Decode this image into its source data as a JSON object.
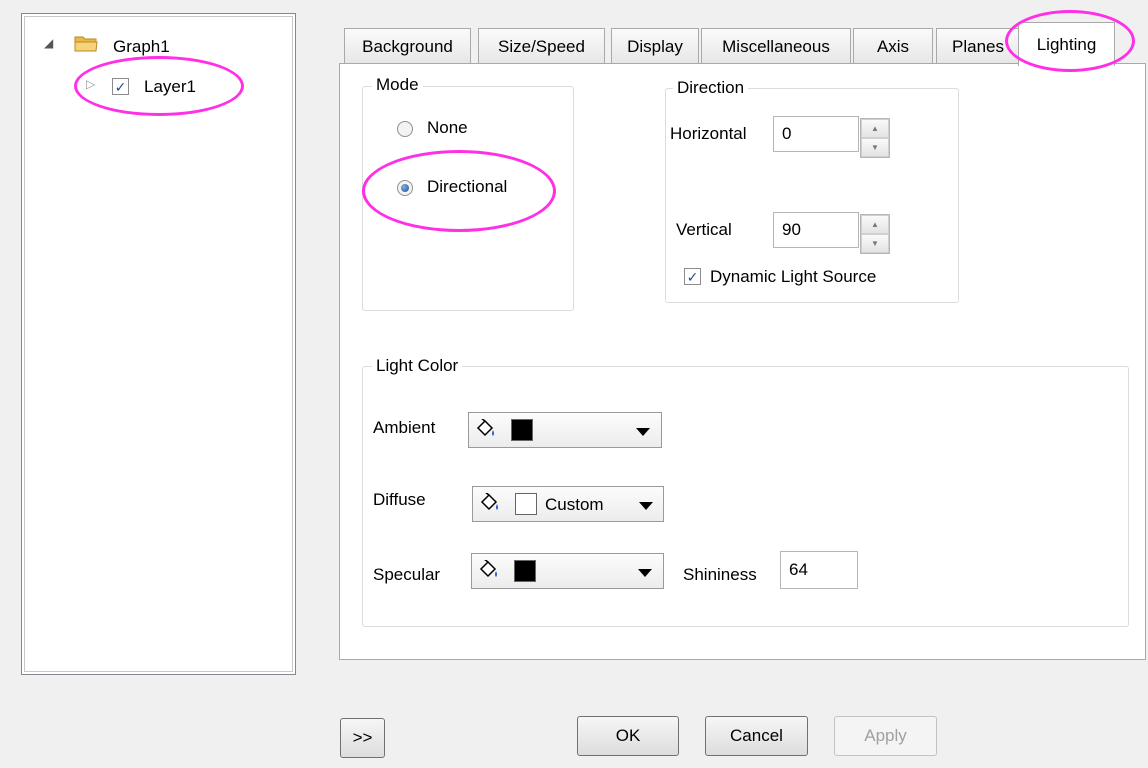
{
  "tree": {
    "root_label": "Graph1",
    "child_label": "Layer1",
    "child_checked": "✓"
  },
  "tabs": [
    {
      "label": "Background"
    },
    {
      "label": "Size/Speed"
    },
    {
      "label": "Display"
    },
    {
      "label": "Miscellaneous"
    },
    {
      "label": "Axis"
    },
    {
      "label": "Planes"
    },
    {
      "label": "Lighting",
      "active": true
    }
  ],
  "mode": {
    "title": "Mode",
    "options": [
      {
        "label": "None",
        "selected": false
      },
      {
        "label": "Directional",
        "selected": true
      }
    ]
  },
  "direction": {
    "title": "Direction",
    "horizontal_label": "Horizontal",
    "horizontal_value": "0",
    "vertical_label": "Vertical",
    "vertical_value": "90",
    "dynamic_label": "Dynamic Light Source",
    "dynamic_checked": "✓"
  },
  "light_color": {
    "title": "Light Color",
    "ambient_label": "Ambient",
    "ambient_color": "#000000",
    "ambient_text": "",
    "diffuse_label": "Diffuse",
    "diffuse_color": "#ffffff",
    "diffuse_text": "Custom",
    "specular_label": "Specular",
    "specular_color": "#000000",
    "specular_text": "",
    "shininess_label": "Shininess",
    "shininess_value": "64"
  },
  "buttons": {
    "expand": ">>",
    "ok": "OK",
    "cancel": "Cancel",
    "apply": "Apply"
  },
  "colors": {
    "highlight": "#ff2fe6",
    "selection": "#1c4e8f"
  }
}
